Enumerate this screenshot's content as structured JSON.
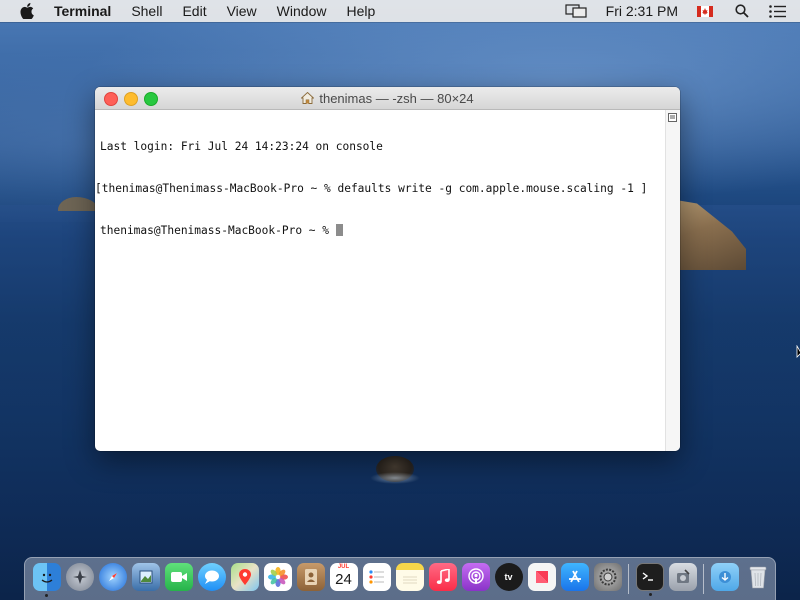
{
  "menubar": {
    "app_name": "Terminal",
    "menus": [
      "Shell",
      "Edit",
      "View",
      "Window",
      "Help"
    ],
    "clock": "Fri 2:31 PM",
    "icons": [
      "apple-icon",
      "display-mirroring-icon",
      "canada-flag-icon",
      "spotlight-icon",
      "notification-center-icon"
    ]
  },
  "terminal": {
    "title": "thenimas — -zsh — 80×24",
    "lines": [
      "Last login: Fri Jul 24 14:23:24 on console",
      "[thenimas@Thenimass-MacBook-Pro ~ % defaults write -g com.apple.mouse.scaling -1 ]",
      "thenimas@Thenimass-MacBook-Pro ~ % "
    ]
  },
  "dock": {
    "calendar_month": "JUL",
    "calendar_day": "24",
    "apps": [
      {
        "name": "finder",
        "color": "#3d8fe0"
      },
      {
        "name": "launchpad",
        "color": "#8e97a6"
      },
      {
        "name": "safari",
        "color": "#2f7de0"
      },
      {
        "name": "mail-preview",
        "color": "#5b8fc7"
      },
      {
        "name": "facetime",
        "color": "#3ec45a"
      },
      {
        "name": "messages",
        "color": "#35a6f5"
      },
      {
        "name": "maps",
        "color": "#6ec26a"
      },
      {
        "name": "photos",
        "color": "#ffffff"
      },
      {
        "name": "contacts",
        "color": "#b08358"
      },
      {
        "name": "calendar",
        "color": "#ffffff"
      },
      {
        "name": "reminders",
        "color": "#ffffff"
      },
      {
        "name": "notes",
        "color": "#f7d64a"
      },
      {
        "name": "music",
        "color": "#fc3c5f"
      },
      {
        "name": "podcasts",
        "color": "#9b45d6"
      },
      {
        "name": "apple-tv",
        "color": "#1b1b1b"
      },
      {
        "name": "news",
        "color": "#f2f2f2"
      },
      {
        "name": "app-store",
        "color": "#2b8cf5"
      },
      {
        "name": "system-preferences",
        "color": "#8a8a8a"
      },
      {
        "name": "terminal",
        "color": "#1e1e1e"
      },
      {
        "name": "disk-utility",
        "color": "#b9bec6"
      },
      {
        "name": "downloads-folder",
        "color": "#5fb4ee"
      },
      {
        "name": "trash",
        "color": "#d9dde3"
      }
    ]
  }
}
